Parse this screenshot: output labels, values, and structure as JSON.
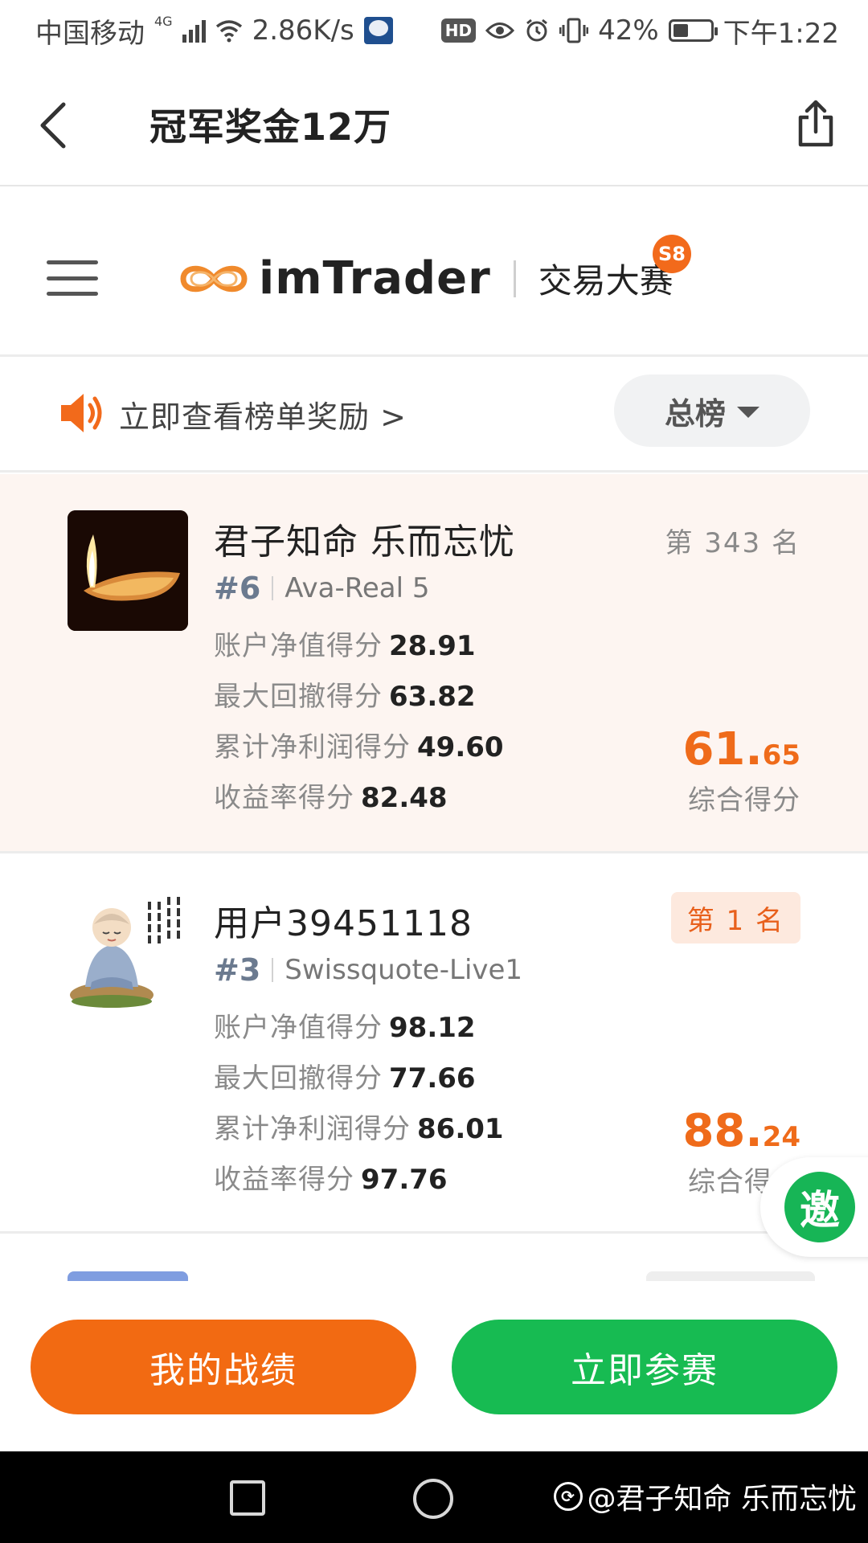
{
  "status_bar": {
    "carrier": "中国移动",
    "network": "4G",
    "speed": "2.86K/s",
    "hd": "HD",
    "battery": "42%",
    "battery_level": 0.42,
    "time": "下午1:22",
    "icons": [
      "signal-icon",
      "wifi-icon",
      "globe-app-icon",
      "eye-icon",
      "alarm-icon",
      "vibrate-icon",
      "battery-icon"
    ]
  },
  "app_bar": {
    "title": "冠军奖金12万",
    "icons": [
      "back-arrow-icon",
      "share-icon"
    ]
  },
  "brand": {
    "name": "imTrader",
    "subtitle": "交易大赛",
    "season": "S8",
    "logo_color": "#f08a2c"
  },
  "notice": {
    "text": "立即查看榜单奖励 >",
    "board": "总榜",
    "speaker_color": "#f26a1b"
  },
  "cards": [
    {
      "name": "君子知命 乐而忘忧",
      "account_no": "#6",
      "server": "Ava-Real 5",
      "metrics": [
        {
          "label": "账户净值得分",
          "value": "28.91"
        },
        {
          "label": "最大回撤得分",
          "value": "63.82"
        },
        {
          "label": "累计净利润得分",
          "value": "49.60"
        },
        {
          "label": "收益率得分",
          "value": "82.48"
        }
      ],
      "rank": "第 343 名",
      "score_int": "61.",
      "score_dec": "65",
      "score_label": "综合得分"
    },
    {
      "name": "用户39451118",
      "account_no": "#3",
      "server": "Swissquote-Live1",
      "metrics": [
        {
          "label": "账户净值得分",
          "value": "98.12"
        },
        {
          "label": "最大回撤得分",
          "value": "77.66"
        },
        {
          "label": "累计净利润得分",
          "value": "86.01"
        },
        {
          "label": "收益率得分",
          "value": "97.76"
        }
      ],
      "rank": "第 1 名",
      "score_int": "88.",
      "score_dec": "24",
      "score_label": "综合得分"
    }
  ],
  "invite": {
    "label": "邀"
  },
  "bottom": {
    "my_record": "我的战绩",
    "join_now": "立即参赛",
    "accent_orange": "#f26a12",
    "accent_green": "#17bb52"
  },
  "watermark": {
    "text": "@君子知命 乐而忘忧"
  }
}
